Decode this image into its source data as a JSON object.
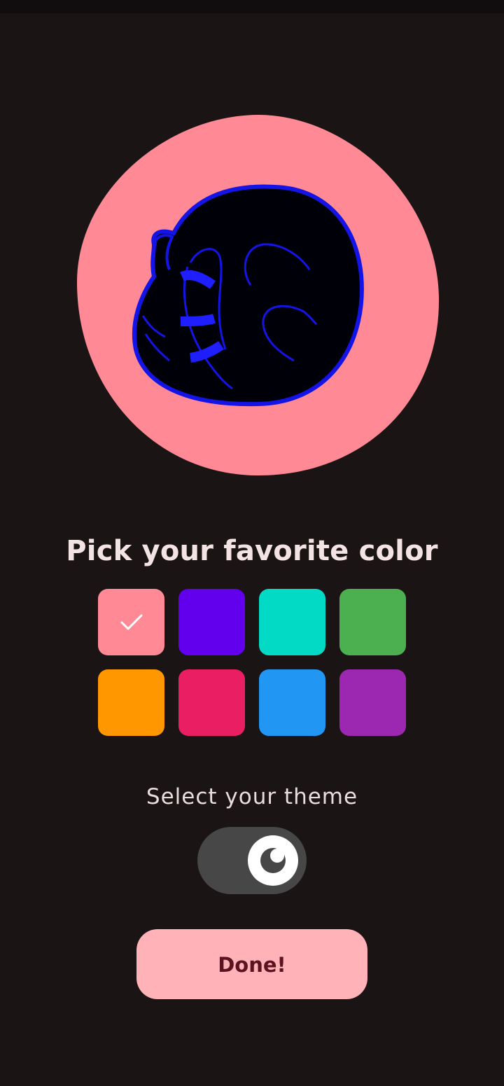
{
  "picker": {
    "title": "Pick your favorite color",
    "selected_index": 0,
    "swatches": [
      {
        "color": "#ff8a95",
        "selected": true
      },
      {
        "color": "#6200ee",
        "selected": false
      },
      {
        "color": "#03dac5",
        "selected": false
      },
      {
        "color": "#4caf50",
        "selected": false
      },
      {
        "color": "#ff9800",
        "selected": false
      },
      {
        "color": "#e91e63",
        "selected": false
      },
      {
        "color": "#2196f3",
        "selected": false
      },
      {
        "color": "#9c27b0",
        "selected": false
      }
    ],
    "check_icon": "check-icon"
  },
  "theme": {
    "label": "Select your theme",
    "mode": "dark",
    "icon": "moon-icon",
    "track_color": "#474747"
  },
  "actions": {
    "done_label": "Done!"
  },
  "avatar": {
    "background_color": "#ff8a95",
    "figure_color": "#000008",
    "outline_color": "#1414e6"
  }
}
